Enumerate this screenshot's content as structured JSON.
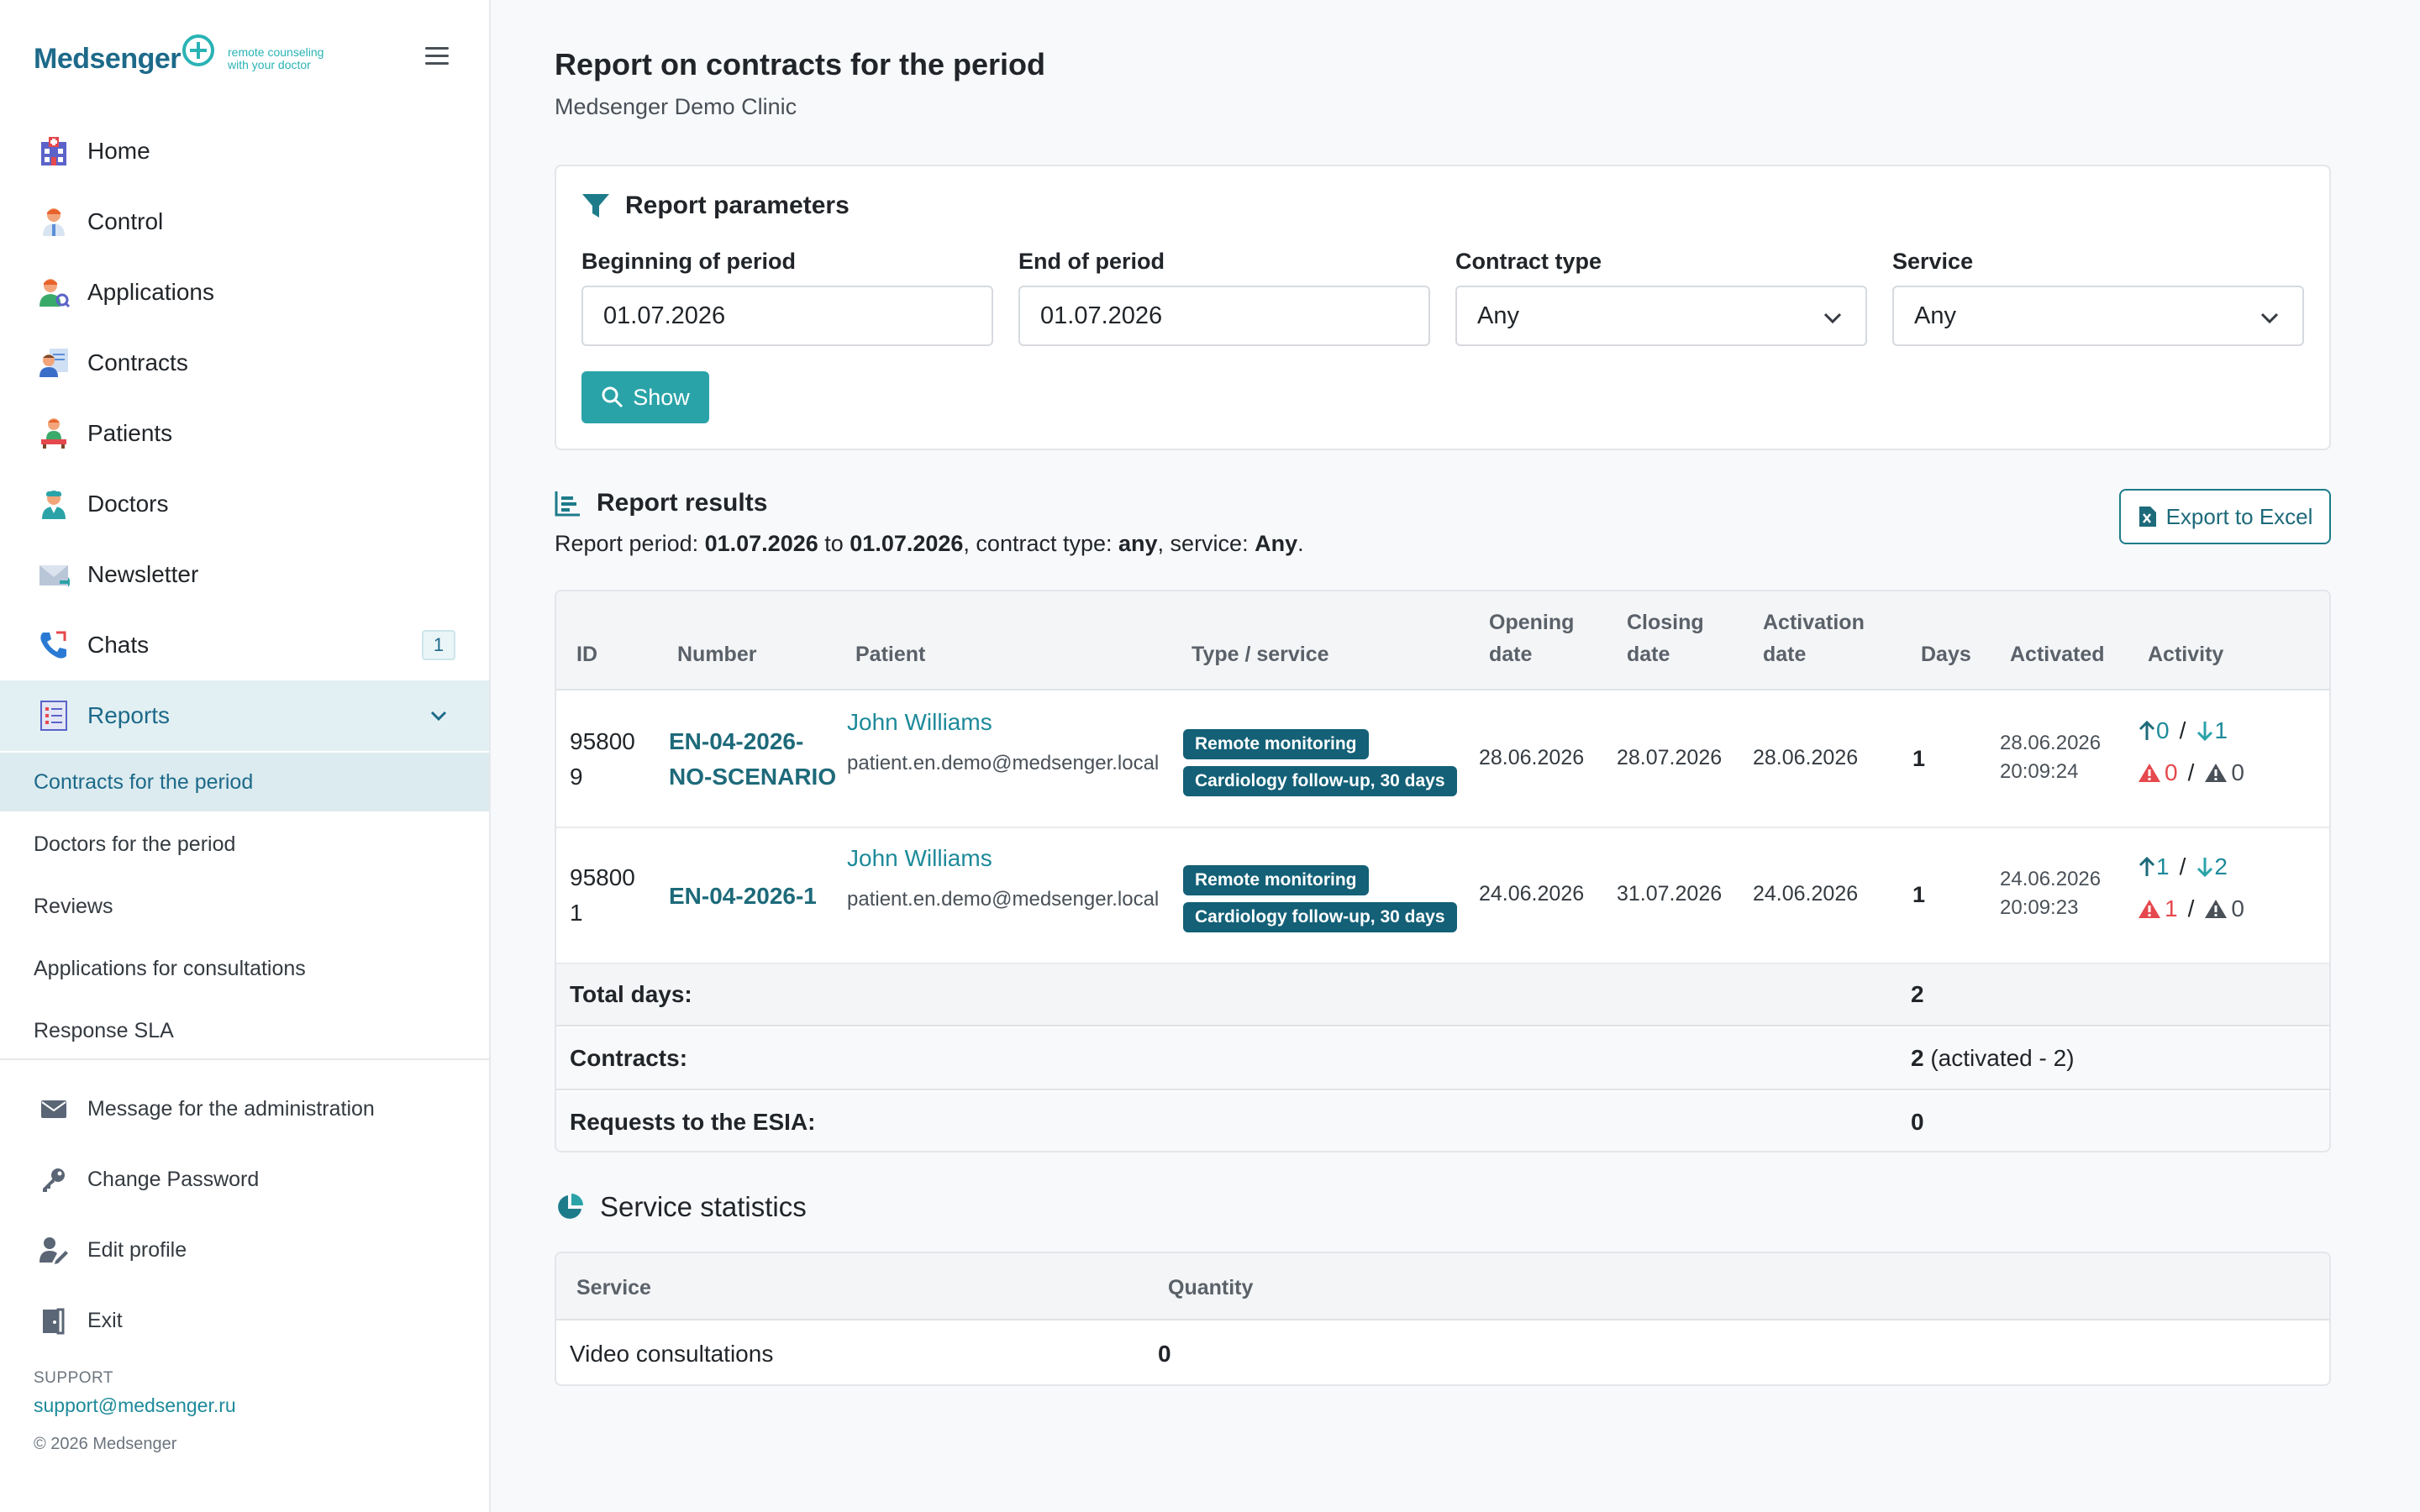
{
  "brand": {
    "name": "Medsenger",
    "tagline_line1": "remote counseling",
    "tagline_line2": "with your doctor"
  },
  "sidebar": {
    "items": [
      {
        "label": "Home",
        "icon": "hospital-icon"
      },
      {
        "label": "Control",
        "icon": "doctor-icon"
      },
      {
        "label": "Applications",
        "icon": "user-search-icon"
      },
      {
        "label": "Contracts",
        "icon": "contract-user-icon"
      },
      {
        "label": "Patients",
        "icon": "patient-icon"
      },
      {
        "label": "Doctors",
        "icon": "medic-icon"
      },
      {
        "label": "Newsletter",
        "icon": "envelope-icon"
      },
      {
        "label": "Chats",
        "icon": "phone-icon",
        "badge": "1"
      },
      {
        "label": "Reports",
        "icon": "report-icon"
      }
    ],
    "subitems": [
      {
        "label": "Contracts for the period"
      },
      {
        "label": "Doctors for the period"
      },
      {
        "label": "Reviews"
      },
      {
        "label": "Applications for consultations"
      },
      {
        "label": "Response SLA"
      }
    ],
    "utility": [
      {
        "label": "Message for the administration",
        "icon": "mail-icon"
      },
      {
        "label": "Change Password",
        "icon": "key-icon"
      },
      {
        "label": "Edit profile",
        "icon": "user-edit-icon"
      },
      {
        "label": "Exit",
        "icon": "door-exit-icon"
      }
    ],
    "support_label": "SUPPORT",
    "support_email": "support@medsenger.ru",
    "copyright": "© 2026 Medsenger"
  },
  "page": {
    "title": "Report on contracts for the period",
    "subtitle": "Medsenger Demo Clinic"
  },
  "params": {
    "heading": "Report parameters",
    "begin_label": "Beginning of period",
    "begin_value": "01.07.2026",
    "end_label": "End of period",
    "end_value": "01.07.2026",
    "type_label": "Contract type",
    "type_value": "Any",
    "service_label": "Service",
    "service_value": "Any",
    "show_label": "Show"
  },
  "results": {
    "heading": "Report results",
    "export_label": "Export to Excel",
    "desc_prefix": "Report period: ",
    "desc_from": "01.07.2026",
    "desc_to_word": " to ",
    "desc_to": "01.07.2026",
    "desc_type_word": ", contract type: ",
    "desc_type": "any",
    "desc_service_word": ", service: ",
    "desc_service": "Any",
    "desc_end": ".",
    "columns": {
      "id": "ID",
      "number": "Number",
      "patient": "Patient",
      "type": "Type / service",
      "opening_1": "Opening",
      "opening_2": "date",
      "closing_1": "Closing",
      "closing_2": "date",
      "activation_1": "Activation",
      "activation_2": "date",
      "days": "Days",
      "activated": "Activated",
      "activity": "Activity"
    },
    "rows": [
      {
        "id": "958009",
        "number": "EN-04-2026-NO-SCENARIO",
        "patient_name": "John Williams",
        "patient_email": "patient.en.demo@medsenger.local",
        "tag1": "Remote monitoring",
        "tag2": "Cardiology follow-up, 30 days",
        "opening": "28.06.2026",
        "closing": "28.07.2026",
        "activation": "28.06.2026",
        "days": "1",
        "activated_date": "28.06.2026",
        "activated_time": "20:09:24",
        "act_up": "0",
        "act_down": "1",
        "act_warn_red": "0",
        "act_warn_dark": "0"
      },
      {
        "id": "958001",
        "number": "EN-04-2026-1",
        "patient_name": "John Williams",
        "patient_email": "patient.en.demo@medsenger.local",
        "tag1": "Remote monitoring",
        "tag2": "Cardiology follow-up, 30 days",
        "opening": "24.06.2026",
        "closing": "31.07.2026",
        "activation": "24.06.2026",
        "days": "1",
        "activated_date": "24.06.2026",
        "activated_time": "20:09:23",
        "act_up": "1",
        "act_down": "2",
        "act_warn_red": "1",
        "act_warn_dark": "0"
      }
    ],
    "summary": {
      "total_days_label": "Total days:",
      "total_days_value": "2",
      "contracts_label": "Contracts:",
      "contracts_value": "2",
      "contracts_extra": " (activated - 2)",
      "esia_label": "Requests to the ESIA:",
      "esia_value": "0"
    }
  },
  "stats": {
    "heading": "Service statistics",
    "col_service": "Service",
    "col_quantity": "Quantity",
    "rows": [
      {
        "service": "Video consultations",
        "quantity": "0"
      }
    ]
  },
  "colors": {
    "accent": "#2aa3a8",
    "brand": "#1d6a8a",
    "pill": "#136077",
    "warn": "#e5484d"
  }
}
